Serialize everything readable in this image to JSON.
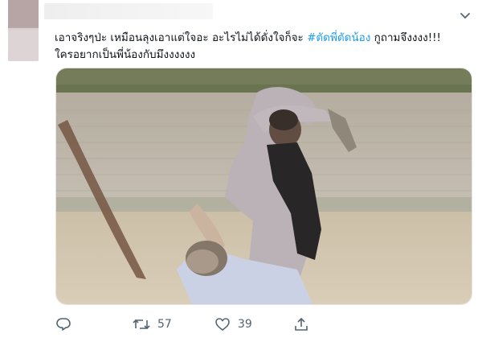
{
  "tweet": {
    "text_line_1_part_1": "เอาจริงๆป่ะ เหมือนลุงเอาแต่ใจอะ อะไรไม่ได้ดั่งใจก็จะ ",
    "hashtag": "#ตัดพี่ตัดน้อง",
    "text_line_1_part_2": " กูถามจึงงงง!!!",
    "text_line_2": "ใครอยากเป็นพี่น้องกับมึงงงงงง",
    "image_alt": "Man in a long black scarf swinging a machete at another man knocked down on a dirt ground, brick wall behind them"
  },
  "actions": {
    "retweet_count": "57",
    "like_count": "39"
  },
  "colors": {
    "hashtag": "#1d9bf0",
    "icon": "#536471",
    "text": "#0f1419"
  },
  "icons": [
    "chevron-down-icon",
    "reply-icon",
    "retweet-icon",
    "like-icon",
    "share-icon"
  ]
}
